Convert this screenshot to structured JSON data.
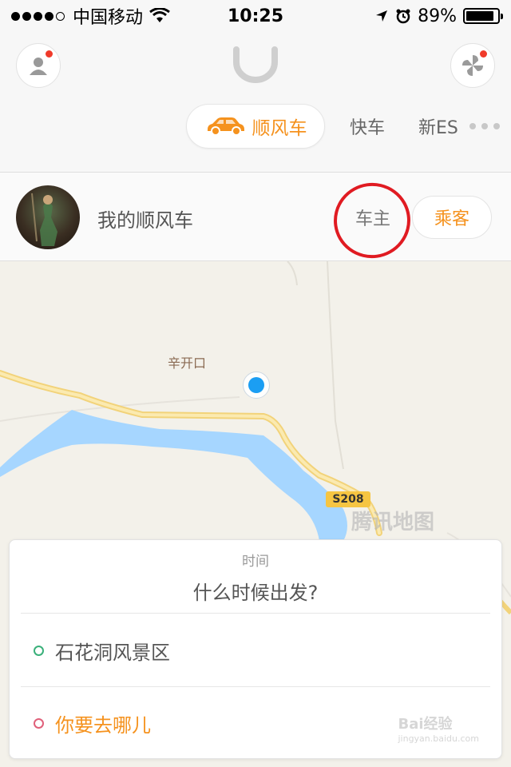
{
  "status_bar": {
    "carrier": "中国移动",
    "time": "10:25",
    "battery": "89%",
    "battery_level": 0.89
  },
  "header": {
    "tabs": [
      {
        "label": "顺风车",
        "active": true,
        "icon": "car-icon"
      },
      {
        "label": "快车",
        "active": false
      },
      {
        "label": "新ES",
        "active": false
      }
    ]
  },
  "profile": {
    "title": "我的顺风车",
    "role_driver": "车主",
    "role_passenger": "乘客"
  },
  "map": {
    "place_label": "辛开口",
    "road_shield": "S208",
    "watermark": "腾讯地图"
  },
  "trip_card": {
    "time_label": "时间",
    "time_prompt": "什么时候出发?",
    "origin": "石花洞风景区",
    "destination_placeholder": "你要去哪儿"
  },
  "colors": {
    "accent": "#f5921e",
    "origin_dot": "#3ab07a",
    "destination_dot": "#e0607a",
    "annotation": "#e01b22",
    "location": "#1b9ef3"
  },
  "watermark": {
    "baidu": "Bai经验",
    "baidu_url": "jingyan.baidu.com"
  }
}
